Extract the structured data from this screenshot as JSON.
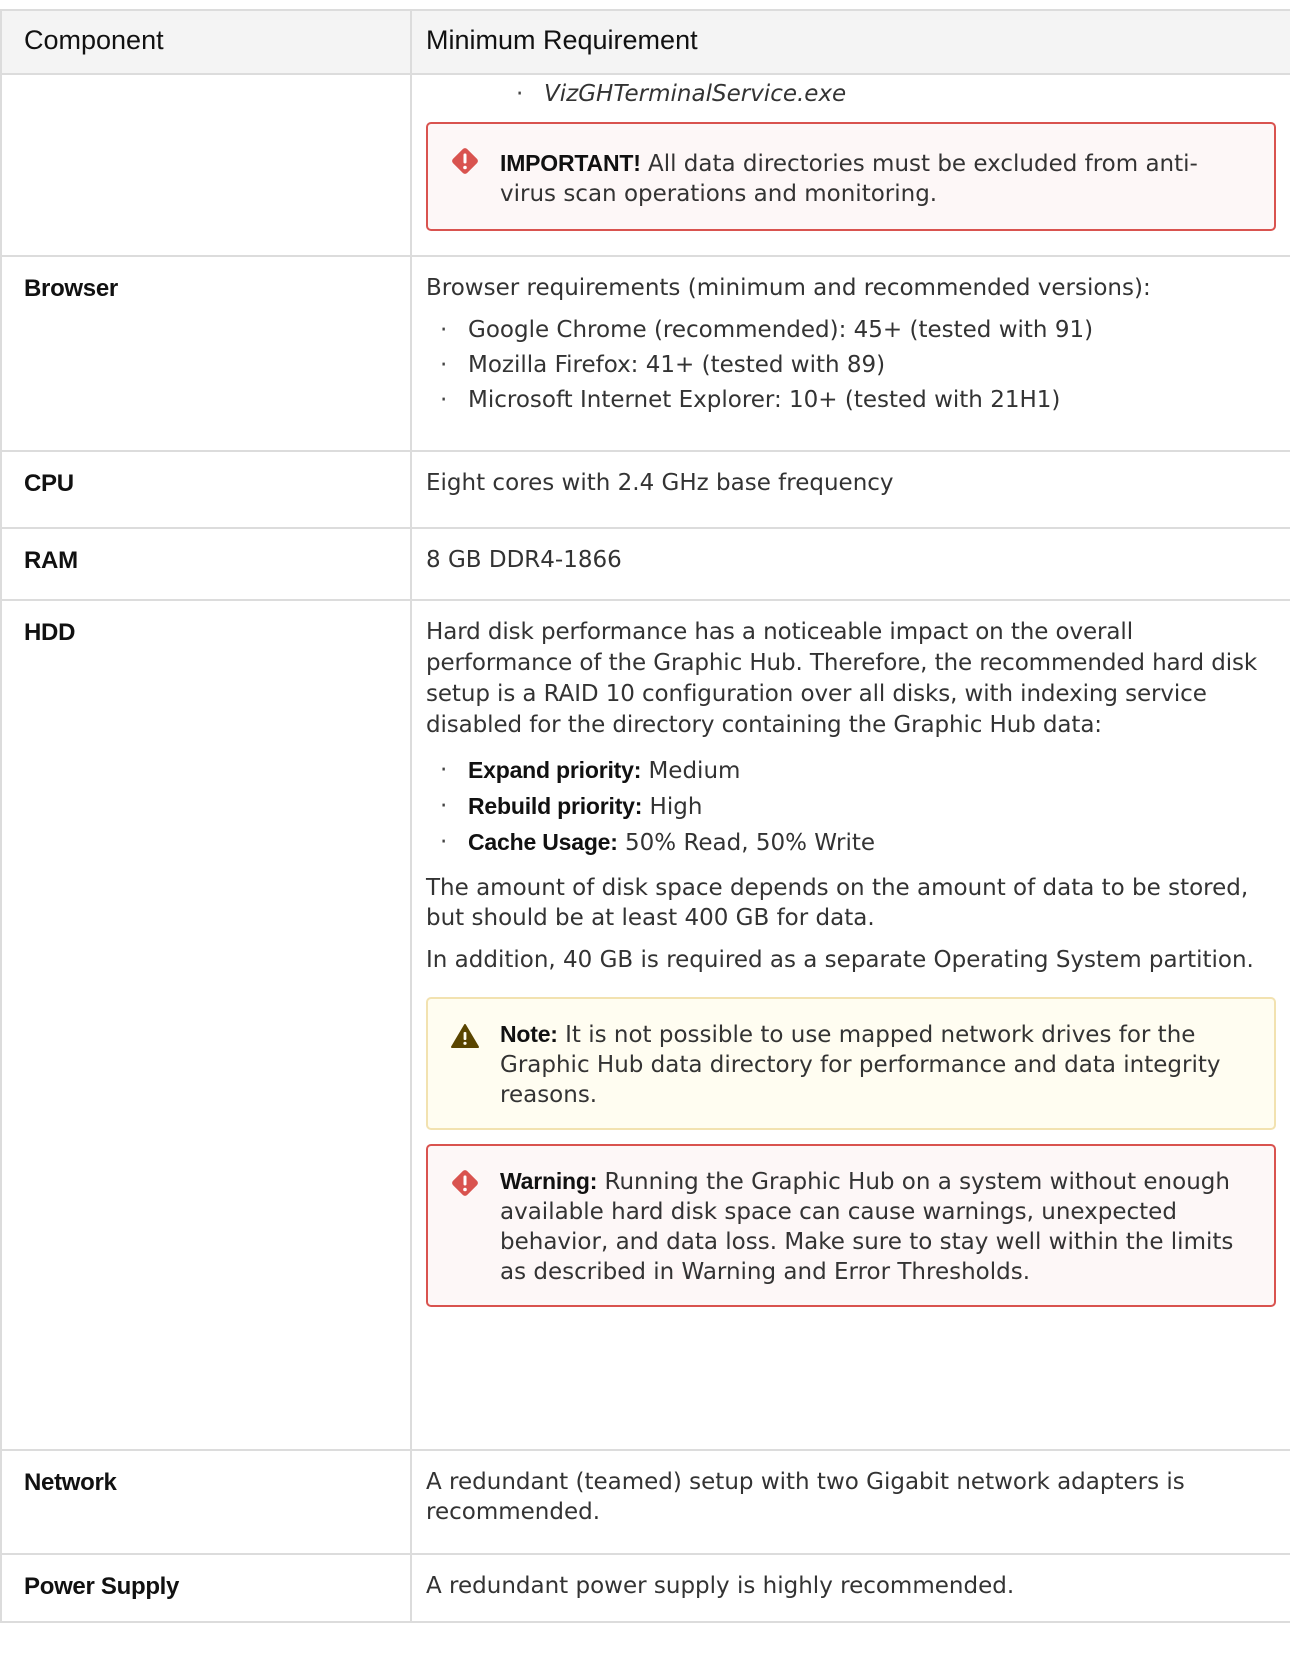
{
  "header": {
    "component": "Component",
    "minimum": "Minimum Requirement"
  },
  "continued": {
    "item": "VizGHTerminalService.exe",
    "important_label": "IMPORTANT!",
    "important_text": " All data directories must be excluded from anti-virus scan operations and monitoring."
  },
  "browser": {
    "label": "Browser",
    "intro": "Browser requirements (minimum and recommended versions):",
    "items": [
      "Google Chrome (recommended): 45+ (tested with 91)",
      "Mozilla Firefox: 41+ (tested with 89)",
      "Microsoft Internet Explorer: 10+ (tested with 21H1)"
    ]
  },
  "cpu": {
    "label": "CPU",
    "value": "Eight cores with 2.4 GHz base frequency"
  },
  "ram": {
    "label": "RAM",
    "value": "8 GB DDR4-1866"
  },
  "hdd": {
    "label": "HDD",
    "intro": "Hard disk performance has a noticeable impact on the overall performance of the Graphic Hub. Therefore, the recommended hard disk setup is a RAID 10 configuration over all disks, with indexing service disabled for the directory containing the Graphic Hub data:",
    "settings": [
      {
        "name": "Expand priority:",
        "value": " Medium"
      },
      {
        "name": "Rebuild priority:",
        "value": " High"
      },
      {
        "name": "Cache Usage:",
        "value": " 50% Read, 50% Write"
      }
    ],
    "space": "The amount of disk space depends on the amount of data to be stored, but should be at least 400 GB for data.",
    "os": "In addition, 40 GB is required as a separate Operating System partition.",
    "note_label": "Note:",
    "note_text": " It is not possible to use mapped network drives for the Graphic Hub data directory for performance and data integrity reasons.",
    "warning_label": "Warning:",
    "warning_text": " Running the Graphic Hub on a system without enough available hard disk space can cause warnings, unexpected behavior, and data loss. Make sure to stay well within the limits as described in Warning and Error Thresholds."
  },
  "network": {
    "label": "Network",
    "value": "A redundant (teamed) setup with two Gigabit network adapters is recommended."
  },
  "power": {
    "label": "Power Supply",
    "value": "A redundant power supply is highly recommended."
  },
  "colors": {
    "danger": "#d9534f",
    "note_border": "#f2e2b0",
    "note_icon": "#5a4500"
  }
}
